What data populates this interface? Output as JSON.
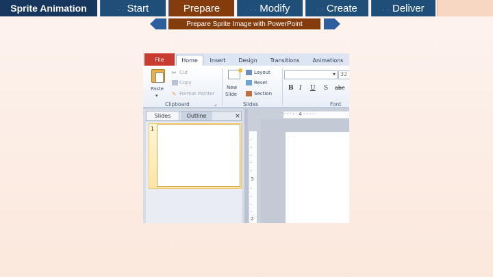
{
  "nav": {
    "title": "Sprite Animation",
    "tabs": [
      {
        "label": "Start",
        "active": false
      },
      {
        "label": "Prepare",
        "active": true
      },
      {
        "label": "Modify",
        "active": false
      },
      {
        "label": "Create",
        "active": false
      },
      {
        "label": "Deliver",
        "active": false
      }
    ],
    "colors": {
      "nav_bg": "#1f4e79",
      "active_bg": "#843c0c",
      "title_bg": "#17375e",
      "page_bg": "#fdeee6"
    }
  },
  "subtitle": {
    "text": "Prepare Sprite Image with PowerPoint",
    "prev_icon": "arrow-left-icon",
    "next_icon": "arrow-right-icon"
  },
  "ppt": {
    "tabs": [
      "File",
      "Home",
      "Insert",
      "Design",
      "Transitions",
      "Animations"
    ],
    "clipboard": {
      "paste": "Paste",
      "cut": "Cut",
      "copy": "Copy",
      "format_painter": "Format Painter",
      "group": "Clipboard"
    },
    "slides_group": {
      "new_slide_line1": "New",
      "new_slide_line2": "Slide",
      "layout": "Layout",
      "reset": "Reset",
      "section": "Section",
      "group": "Slides"
    },
    "font_group": {
      "size": "32",
      "bold": "B",
      "italic": "I",
      "underline": "U",
      "strike": "S",
      "shadow": "abc",
      "group": "Font"
    },
    "pane_tabs": {
      "slides": "Slides",
      "outline": "Outline",
      "close": "×"
    },
    "slide_number": "1",
    "vruler": [
      "3",
      "2"
    ],
    "hruler": "· · · · · 4 · · · ·"
  }
}
